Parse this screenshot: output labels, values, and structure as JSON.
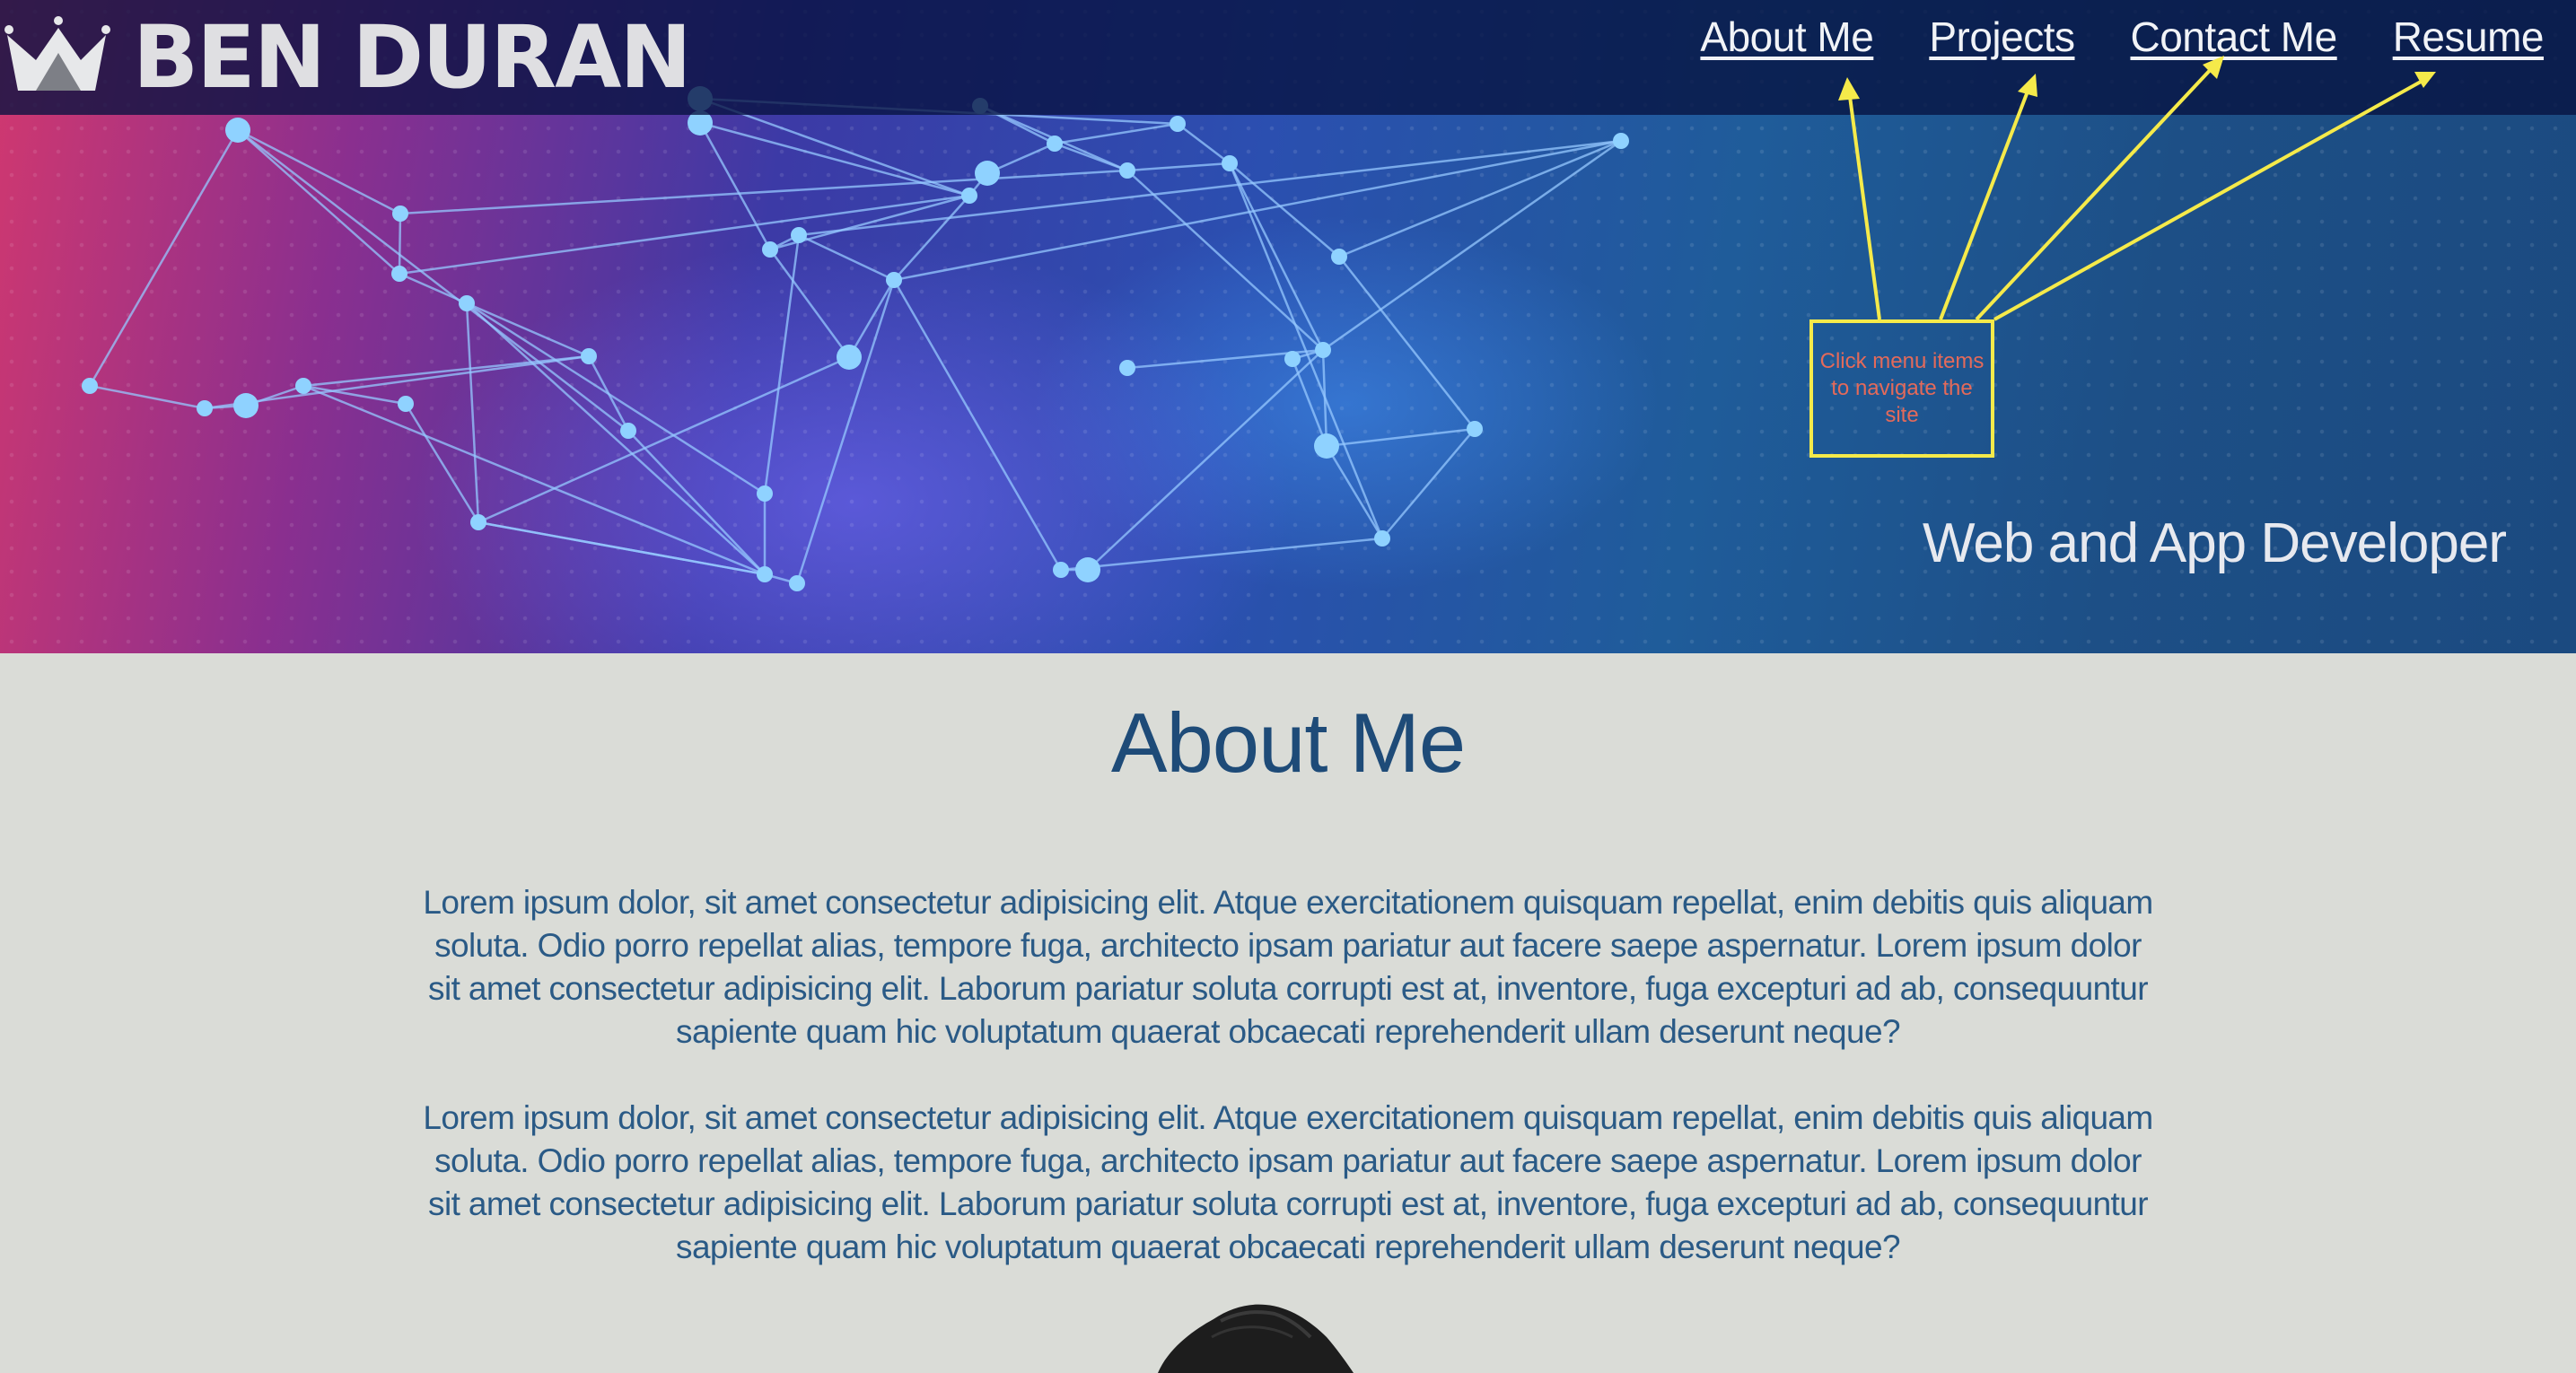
{
  "header": {
    "brand_name": "BEN DURAN",
    "logo_icon": "crown-icon",
    "nav": [
      {
        "label": "About Me"
      },
      {
        "label": "Projects"
      },
      {
        "label": "Contact Me"
      },
      {
        "label": "Resume"
      }
    ]
  },
  "hero": {
    "tagline": "Web and App Developer",
    "annotation": "Click menu items to navigate the site",
    "annotation_color": "#f5ea4a"
  },
  "about": {
    "title": "About Me",
    "paragraphs": [
      "Lorem ipsum dolor, sit amet consectetur adipisicing elit. Atque exercitationem quisquam repellat, enim debitis quis aliquam soluta. Odio porro repellat alias, tempore fuga, architecto ipsam pariatur aut facere saepe aspernatur. Lorem ipsum dolor sit amet consectetur adipisicing elit. Laborum pariatur soluta corrupti est at, inventore, fuga excepturi ad ab, consequuntur sapiente quam hic voluptatum quaerat obcaecati reprehenderit ullam deserunt neque?",
      "Lorem ipsum dolor, sit amet consectetur adipisicing elit. Atque exercitationem quisquam repellat, enim debitis quis aliquam soluta. Odio porro repellat alias, tempore fuga, architecto ipsam pariatur aut facere saepe aspernatur. Lorem ipsum dolor sit amet consectetur adipisicing elit. Laborum pariatur soluta corrupti est at, inventore, fuga excepturi ad ab, consequuntur sapiente quam hic voluptatum quaerat obcaecati reprehenderit ullam deserunt neque?"
    ]
  },
  "colors": {
    "background": "#dadcd7",
    "heading": "#1e4b78",
    "body_text": "#2a5a86",
    "header_bar": "#061240"
  }
}
